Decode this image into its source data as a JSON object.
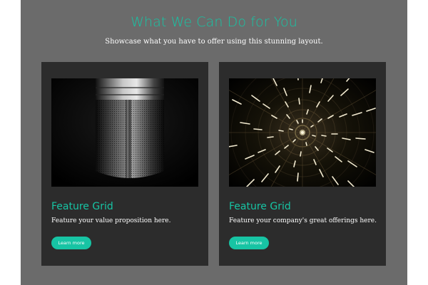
{
  "section": {
    "title": "What We Can Do for You",
    "subtitle": "Showcase what you have to offer using this stunning layout."
  },
  "cards": [
    {
      "image": "microphone-photo",
      "title": "Feature Grid",
      "text": "Feature your value proposition here.",
      "button_label": "Learn more"
    },
    {
      "image": "spiral-ceiling-lights-photo",
      "title": "Feature Grid",
      "text": "Feature your company's great offerings here.",
      "button_label": "Learn more"
    }
  ],
  "colors": {
    "accent": "#17c4a4",
    "page_background": "#6b6b6b",
    "card_background": "#2c2c2c",
    "text_light": "#ffffff"
  }
}
